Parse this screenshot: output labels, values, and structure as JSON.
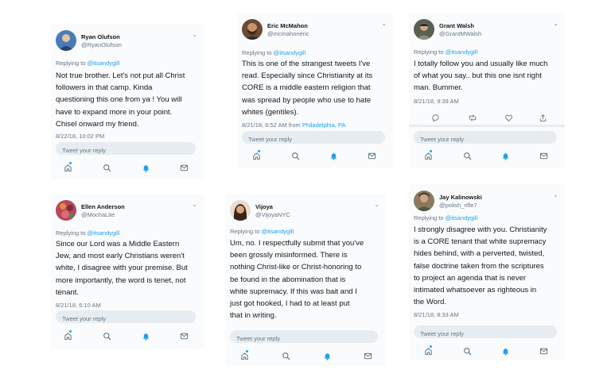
{
  "ui": {
    "replying_label": "Replying to",
    "reply_placeholder": "Tweet your reply",
    "accent_color": "#1da1f2",
    "tabs": [
      "home-icon",
      "search-icon",
      "notifications-icon",
      "messages-icon"
    ]
  },
  "tweets": [
    {
      "name": "Ryan Olufson",
      "handle": "@RyanOlufson",
      "replying_to": "@itsandygill",
      "lines": [
        "Not true brother.  Let's not put all Christ",
        "followers in that camp.  Kinda",
        "questioning this one from ya ! You will",
        "have to expand more in your point.",
        "Chisel onward my friend."
      ],
      "timestamp": "8/22/18, 10:02 PM"
    },
    {
      "name": "Eric McMahon",
      "handle": "@mcmahoneric",
      "replying_to": "@itsandygill",
      "lines": [
        "This is one of the strangest tweets I've",
        "read. Especially since Christianity at its",
        "CORE is a middle eastern religion that",
        "was spread by people who use to hate",
        "whites (gentiles)."
      ],
      "timestamp": "8/21/18, 6:52 AM from ",
      "location": "Philadelphia, PA"
    },
    {
      "name": "Grant Walsh",
      "handle": "@GrantMWalsh",
      "replying_to": "@itsandygill",
      "lines": [
        "I totally follow you and usually like much",
        "of what you say.. but this one isnt right",
        "man. Bummer."
      ],
      "timestamp": "8/21/18, 9:39 AM"
    },
    {
      "name": "Ellen Anderson",
      "handle": "@MochaLite",
      "replying_to": "@itsandygill",
      "lines": [
        "Since our Lord was a Middle Eastern",
        "Jew, and most early Christians weren't",
        "white, I disagree with your premise. But",
        "more importantly, the word is tenet, not",
        "tenant."
      ],
      "timestamp": "8/21/18, 6:10 AM"
    },
    {
      "name": "Vijoya",
      "handle": "@VijoyaNYC",
      "replying_to": "@itsandygill",
      "lines": [
        "Um, no. I respectfully submit that you've",
        "been grossly misinformed. There is",
        "nothing Christ-like or Christ-honoring to",
        "be found in the abomination that is",
        "white supremacy. If this was bait and I",
        "just got hooked, I  had to at least put",
        "that in writing."
      ],
      "timestamp": ""
    },
    {
      "name": "Jay Kalinowski",
      "handle": "@polish_rifle7",
      "replying_to": "@itsandygill",
      "lines": [
        "I strongly disagree with you. Christianity",
        "is a CORE tenant that white supremacy",
        "hides behind, with a perverted, twisted,",
        "false doctrine taken from the scriptures",
        "to project an agenda that is never",
        "intimated whatsoever as righteous in",
        "the Word."
      ],
      "timestamp": "8/21/18, 8:33 AM"
    }
  ]
}
